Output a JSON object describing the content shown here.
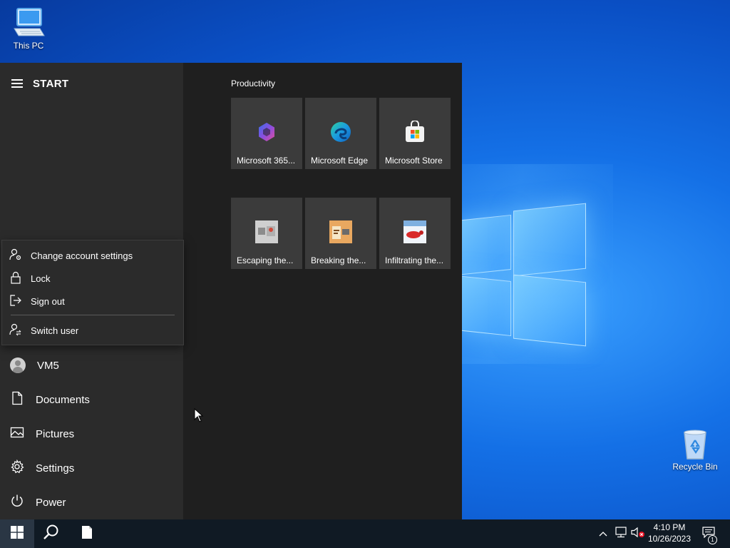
{
  "desktop": {
    "this_pc_label": "This PC",
    "recycle_bin_label": "Recycle Bin"
  },
  "start_menu": {
    "title": "START",
    "account_flyout": {
      "change_account_settings": "Change account settings",
      "lock": "Lock",
      "sign_out": "Sign out",
      "switch_user": "Switch user"
    },
    "nav": {
      "user": "VM5",
      "documents": "Documents",
      "pictures": "Pictures",
      "settings": "Settings",
      "power": "Power"
    },
    "group_title": "Productivity",
    "tiles": [
      {
        "label": "Microsoft 365...",
        "icon": "microsoft-365-icon"
      },
      {
        "label": "Microsoft Edge",
        "icon": "edge-icon"
      },
      {
        "label": "Microsoft Store",
        "icon": "store-icon"
      },
      {
        "label": "Escaping the...",
        "icon": "game-thumbnail"
      },
      {
        "label": "Breaking the...",
        "icon": "game-thumbnail"
      },
      {
        "label": "Infiltrating the...",
        "icon": "game-thumbnail"
      }
    ]
  },
  "taskbar": {
    "time": "4:10 PM",
    "date": "10/26/2023",
    "notification_count": "1"
  },
  "colors": {
    "start_bg": "#1f1f1f",
    "start_left_bg": "#2b2b2b",
    "tile_bg": "#3b3b3b",
    "taskbar_bg": "#101a24"
  }
}
